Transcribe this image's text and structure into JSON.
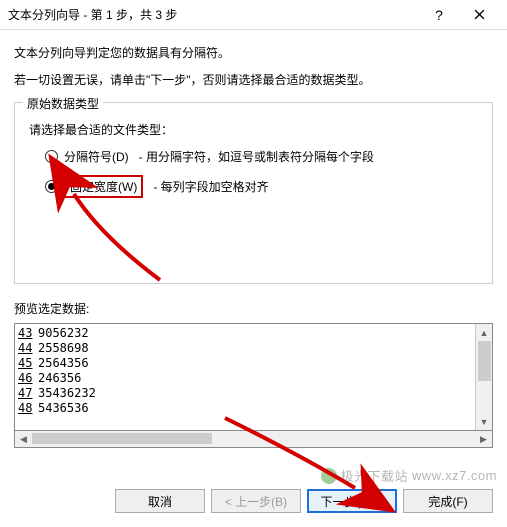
{
  "titlebar": {
    "title": "文本分列向导 - 第 1 步，共 3 步"
  },
  "intro": {
    "line1": "文本分列向导判定您的数据具有分隔符。",
    "line2": "若一切设置无误，请单击\"下一步\"，否则请选择最合适的数据类型。"
  },
  "group": {
    "legend": "原始数据类型",
    "prompt": "请选择最合适的文件类型：",
    "options": [
      {
        "label": "分隔符号(D)",
        "desc": "- 用分隔字符，如逗号或制表符分隔每个字段",
        "checked": false
      },
      {
        "label": "固定宽度(W)",
        "desc": "- 每列字段加空格对齐",
        "checked": true
      }
    ]
  },
  "preview": {
    "label": "预览选定数据:",
    "rows": [
      {
        "n": "43",
        "v": "9056232"
      },
      {
        "n": "44",
        "v": "2558698"
      },
      {
        "n": "45",
        "v": "2564356"
      },
      {
        "n": "46",
        "v": "246356"
      },
      {
        "n": "47",
        "v": "35436232"
      },
      {
        "n": "48",
        "v": "5436536"
      }
    ]
  },
  "buttons": {
    "cancel": "取消",
    "back": "< 上一步(B)",
    "next": "下一步(N) >",
    "finish": "完成(F)"
  },
  "watermark": {
    "text": "极光下载站",
    "url": "www.xz7.com"
  }
}
